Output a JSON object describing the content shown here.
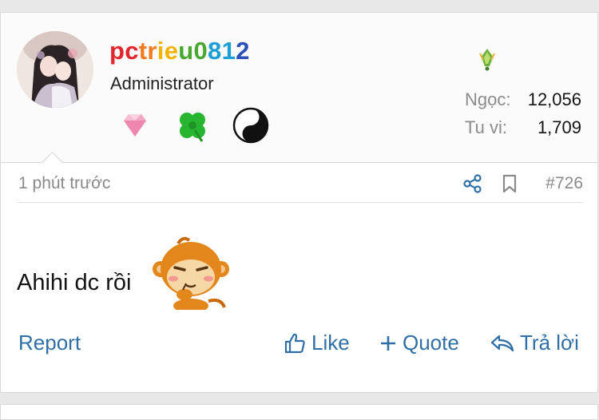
{
  "user": {
    "username": "pctrieu0812",
    "username_colors": [
      "#e3262d",
      "#f47a1f",
      "#f2b400",
      "#49a830",
      "#1d9fd6",
      "#2b51b8",
      "#8e2dab"
    ],
    "role": "Administrator",
    "badges": [
      "diamond-icon",
      "clover-icon",
      "yin-yang-icon"
    ],
    "rank_icon": "jade-icon",
    "stats": [
      {
        "label": "Ngọc:",
        "value": "12,056"
      },
      {
        "label": "Tu vi:",
        "value": "1,709"
      }
    ]
  },
  "post": {
    "time": "1 phút trước",
    "number": "#726",
    "content": "Ahihi dc rồi",
    "sticker": "monkey-emoji"
  },
  "actions": {
    "report": "Report",
    "like": "Like",
    "quote": "Quote",
    "reply": "Trả lời"
  },
  "colors": {
    "link": "#2f6fa6",
    "muted": "#8a8a8a"
  }
}
